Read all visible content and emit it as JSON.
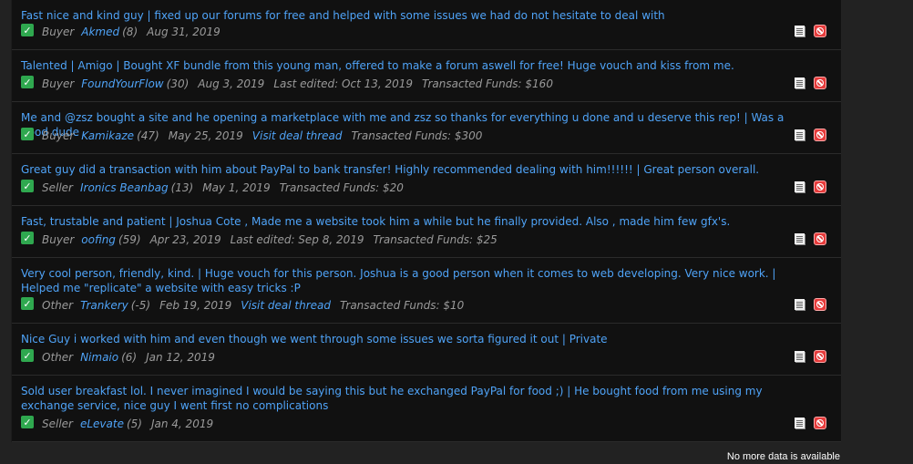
{
  "reviews": [
    {
      "message": "Fast nice and kind guy | fixed up our forums for free and helped with some issues we had do not hesitate to deal with",
      "role": "Buyer",
      "user": "Akmed",
      "score": "(8)",
      "date": "Aug 31, 2019"
    },
    {
      "message": "Talented | Amigo | Bought XF bundle from this young man, offered to make a forum aswell for free! Huge vouch and kiss from me.",
      "role": "Buyer",
      "user": "FoundYourFlow",
      "score": "(30)",
      "date": "Aug 3, 2019",
      "edited": "Last edited: Oct 13, 2019",
      "funds": "Transacted Funds: $160"
    },
    {
      "message": "Me and @zsz bought a site and he opening a marketplace with me and zsz so thanks for everything u done and u deserve this rep! | Was a good dude",
      "role": "Buyer",
      "user": "Kamikaze",
      "score": "(47)",
      "date": "May 25, 2019",
      "deal": "Visit deal thread",
      "funds": "Transacted Funds: $300"
    },
    {
      "message": "Great guy did a transaction with him about PayPal to bank transfer! Highly recommended dealing with him!!!!!! | Great person overall.",
      "role": "Seller",
      "user": "Ironics Beanbag",
      "score": "(13)",
      "date": "May 1, 2019",
      "funds": "Transacted Funds: $20"
    },
    {
      "message": "Fast, trustable and patient | Joshua Cote , Made me a website took him a while but he finally provided. Also , made him few gfx's.",
      "role": "Buyer",
      "user": "oofing",
      "score": "(59)",
      "date": "Apr 23, 2019",
      "edited": "Last edited: Sep 8, 2019",
      "funds": "Transacted Funds: $25"
    },
    {
      "message": "Very cool person, friendly, kind. | Huge vouch for this person. Joshua is a good person when it comes to web developing. Very nice work. | Helped me \"replicate\" a website with easy tricks :P",
      "role": "Other",
      "user": "Trankery",
      "score": "(-5)",
      "date": "Feb 19, 2019",
      "deal": "Visit deal thread",
      "funds": "Transacted Funds: $10"
    },
    {
      "message": "Nice Guy i worked with him and even though we went through some issues we sorta figured it out | Private",
      "role": "Other",
      "user": "Nimaio",
      "score": "(6)",
      "date": "Jan 12, 2019"
    },
    {
      "message": "Sold user breakfast lol. I never imagined I would be saying this but he exchanged PayPal for food ;) | He bought food from me using my exchange service, nice guy I went first no complications",
      "role": "Seller",
      "user": "eLevate",
      "score": "(5)",
      "date": "Jan 4, 2019"
    }
  ],
  "footer": "No more data is available",
  "icons": {
    "positive": "check-icon",
    "note": "note-icon",
    "report": "report-icon"
  },
  "colors": {
    "link": "#4fa3f7",
    "positive": "#2fa84f",
    "report": "#e63b3b"
  }
}
